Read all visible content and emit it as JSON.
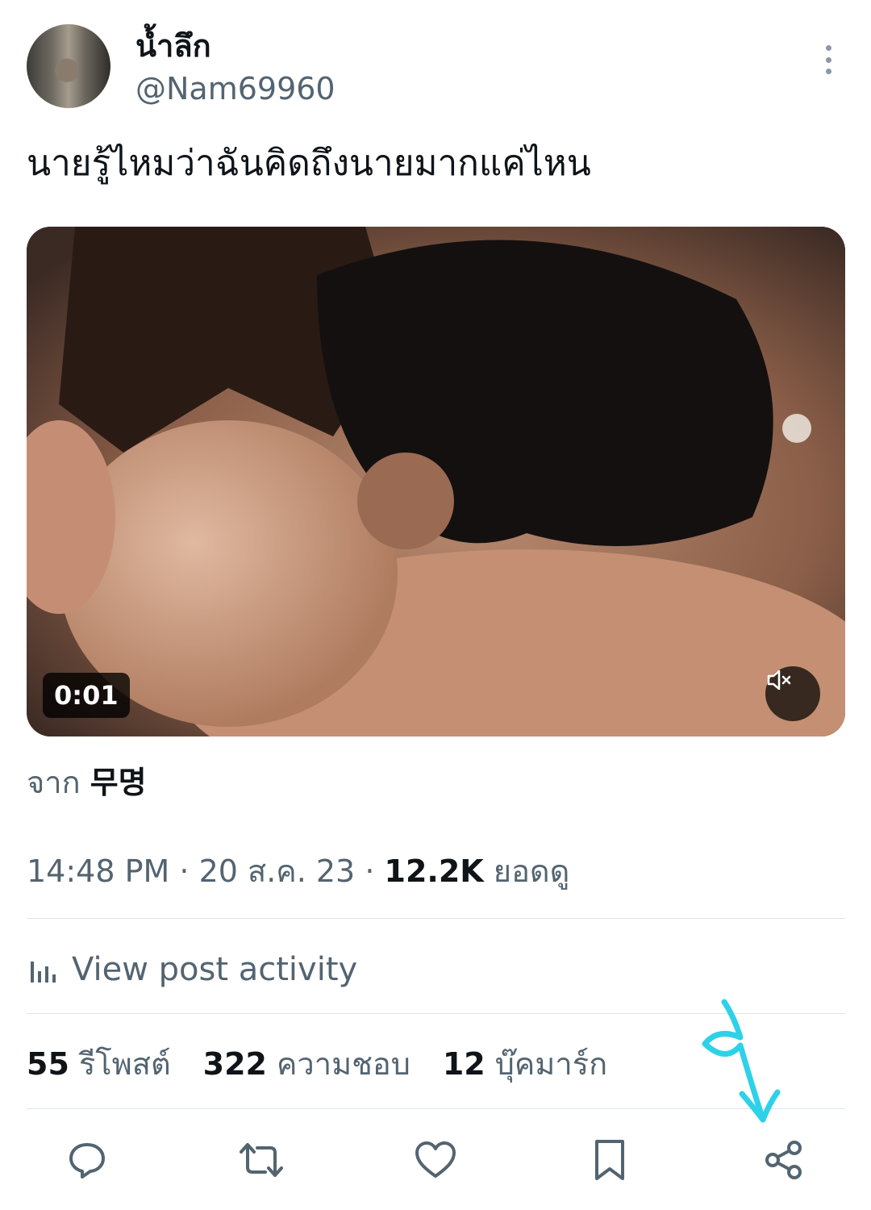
{
  "post": {
    "author": {
      "display_name": "น้ำลึก",
      "handle": "@Nam69960"
    },
    "text": "นายรู้ไหมว่าฉันคิดถึงนายมากแค่ไหน",
    "media": {
      "duration": "0:01",
      "muted": true
    },
    "source_label": "จาก",
    "source_name": "무명",
    "time": "14:48 PM",
    "separator": "·",
    "date": "20 ส.ค. 23",
    "views_count": "12.2K",
    "views_label": "ยอดดู",
    "activity_label": "View post activity",
    "stats": {
      "reposts_count": "55",
      "reposts_label": "รีโพสต์",
      "likes_count": "322",
      "likes_label": "ความชอบ",
      "bookmarks_count": "12",
      "bookmarks_label": "บุ๊คมาร์ก"
    }
  },
  "icons": {
    "more": "more-vertical-icon",
    "reply": "reply-icon",
    "repost": "repost-icon",
    "like": "heart-icon",
    "bookmark": "bookmark-icon",
    "share": "share-icon",
    "mute": "volume-muted-icon",
    "activity": "bar-chart-icon"
  },
  "colors": {
    "text": "#0f1419",
    "secondary": "#536471",
    "annotation": "#2ed1e8"
  }
}
